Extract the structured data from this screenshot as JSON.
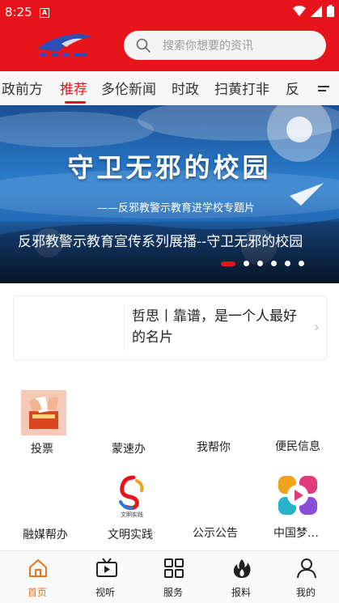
{
  "status_bar": {
    "time": "8:25",
    "notification_badge": "A"
  },
  "header": {
    "search_placeholder": "搜索你想要的资讯",
    "logo_icon": "app-logo-icon"
  },
  "tabs": [
    {
      "label": "政前方"
    },
    {
      "label": "推荐",
      "active": true
    },
    {
      "label": "多伦新闻"
    },
    {
      "label": "时政"
    },
    {
      "label": "扫黄打非"
    },
    {
      "label": "反"
    }
  ],
  "banner": {
    "big_title": "守卫无邪的校园",
    "sub_title": "——反邪教警示教育进学校专题片",
    "caption": "反邪教警示教育宣传系列展播--守卫无邪的校园",
    "slide_count": 6,
    "active_slide": 1
  },
  "quote_card": {
    "text": "哲思丨靠谱，是一个人最好的名片"
  },
  "services": [
    {
      "label": "投票",
      "icon": "vote-box-icon"
    },
    {
      "label": "蒙速办",
      "icon": ""
    },
    {
      "label": "我帮你",
      "icon": ""
    },
    {
      "label": "便民信息",
      "icon": ""
    },
    {
      "label": "融媒帮办",
      "icon": ""
    },
    {
      "label": "文明实践",
      "icon": "civilization-practice-icon",
      "icon_text": "文明实践"
    },
    {
      "label": "公示公告",
      "icon": ""
    },
    {
      "label": "中国梦…",
      "icon": "china-dream-play-icon"
    }
  ],
  "bottom_nav": [
    {
      "label": "首页",
      "icon": "home-icon",
      "active": true
    },
    {
      "label": "视听",
      "icon": "tv-icon"
    },
    {
      "label": "服务",
      "icon": "grid-icon"
    },
    {
      "label": "报料",
      "icon": "fire-icon"
    },
    {
      "label": "我的",
      "icon": "user-icon"
    }
  ],
  "colors": {
    "brand_red": "#e8141c",
    "active_nav": "#e8741c",
    "tab_bg": "#f7f7f7"
  }
}
